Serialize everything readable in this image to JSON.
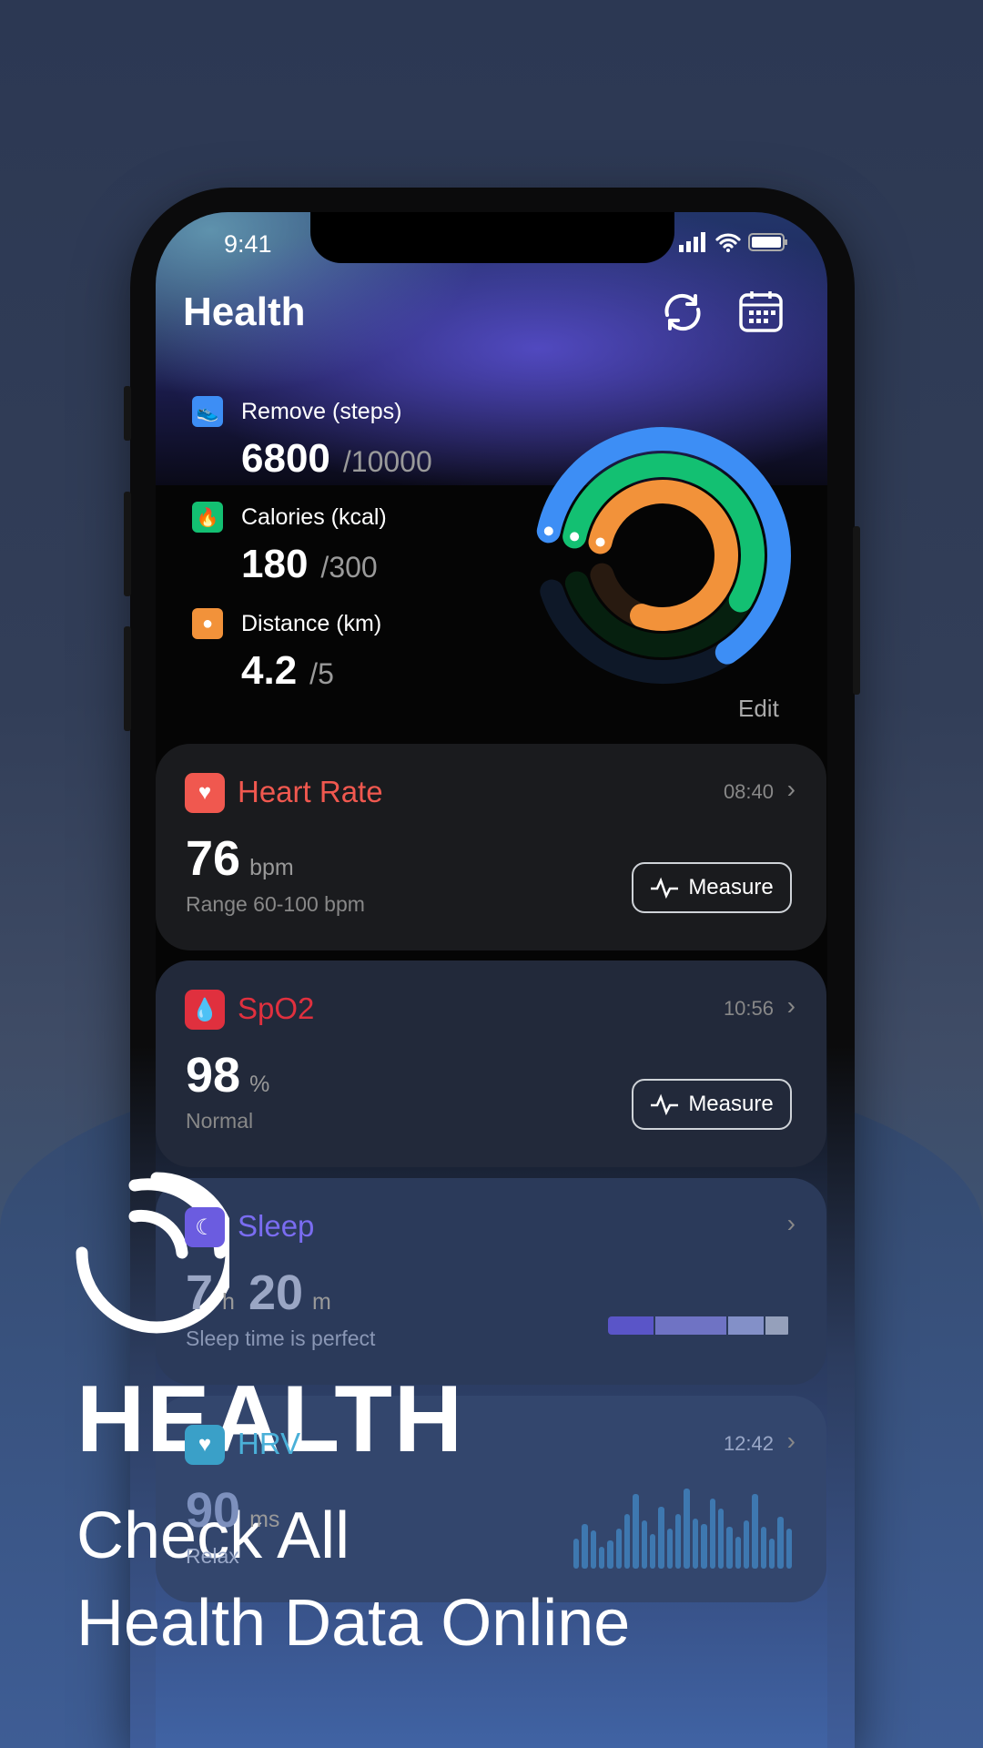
{
  "status_bar": {
    "time": "9:41",
    "icons": [
      "signal-icon",
      "wifi-icon",
      "battery-icon"
    ]
  },
  "header": {
    "title": "Health",
    "icons": [
      "refresh-icon",
      "calendar-icon"
    ]
  },
  "activity": {
    "items": [
      {
        "label": "Remove (steps)",
        "value": "6800",
        "goal": "/10000",
        "icon": "shoe-icon",
        "color": "#3d8ef5",
        "progress": 0.68
      },
      {
        "label": "Calories (kcal)",
        "value": "180",
        "goal": "/300",
        "icon": "flame-icon",
        "color": "#13c072",
        "progress": 0.6
      },
      {
        "label": "Distance (km)",
        "value": "4.2",
        "goal": "/5",
        "icon": "location-pin-icon",
        "color": "#f2923a",
        "progress": 0.84
      }
    ],
    "edit_label": "Edit"
  },
  "cards": {
    "heart": {
      "title": "Heart Rate",
      "time": "08:40",
      "value": "76",
      "unit": "bpm",
      "sub": "Range 60-100 bpm",
      "button": "Measure",
      "color": "#f0584f"
    },
    "spo2": {
      "title": "SpO2",
      "time": "10:56",
      "value": "98",
      "unit": "%",
      "sub": "Normal",
      "button": "Measure",
      "color": "#e0303e"
    },
    "sleep": {
      "title": "Sleep",
      "hours": "7",
      "h_unit": "h",
      "minutes": "20",
      "m_unit": "m",
      "sub": "Sleep time is perfect",
      "color": "#6b5ce0",
      "stages": [
        0.26,
        0.4,
        0.2,
        0.13
      ],
      "stage_colors": [
        "#5a55c8",
        "#6f73c4",
        "#8390c8",
        "#95a0bb"
      ]
    },
    "hrv": {
      "title": "HRV",
      "time": "12:42",
      "value": "90",
      "unit": "ms",
      "sub": "Relax",
      "color": "#3aa0c8",
      "bars": [
        30,
        45,
        38,
        22,
        28,
        40,
        55,
        75,
        48,
        35,
        62,
        40,
        55,
        80,
        50,
        45,
        70,
        60,
        42,
        32,
        48,
        75,
        42,
        30,
        52,
        40
      ]
    }
  },
  "promo": {
    "title": "HEALTH",
    "line1": "Check All",
    "line2": "Health Data Online"
  }
}
